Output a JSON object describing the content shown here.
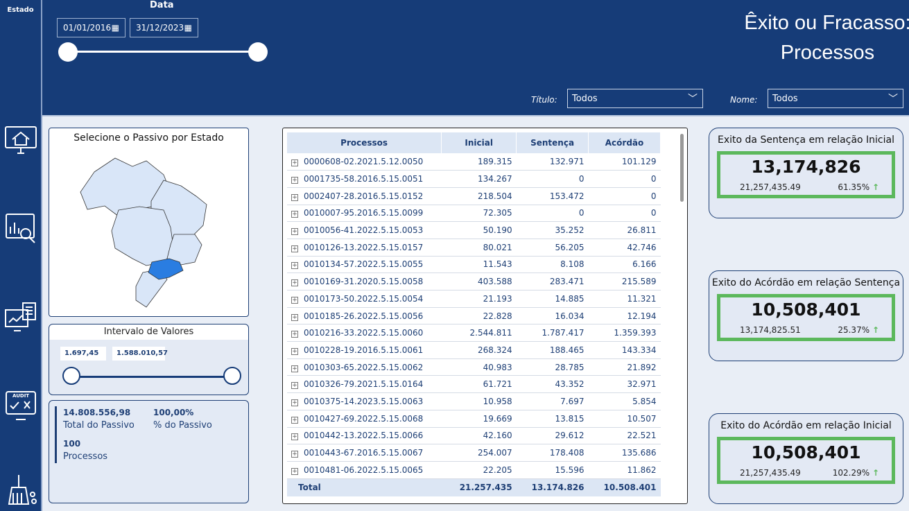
{
  "sidebar": {
    "label": "Estado",
    "icons": [
      "home-monitor-icon",
      "analytics-icon",
      "reports-icon",
      "audit-icon",
      "cleanup-icon"
    ]
  },
  "header": {
    "date_label": "Data",
    "date_start": "01/01/2016",
    "date_end": "31/12/2023",
    "title_line1": "Êxito ou Fracasso:",
    "title_line2": "Processos",
    "titulo_label": "Título:",
    "titulo_value": "Todos",
    "nome_label": "Nome:",
    "nome_value": "Todos",
    "date_range_fraction": [
      0,
      1
    ]
  },
  "map": {
    "title": "Selecione o Passivo por Estado",
    "highlighted_state": "SP"
  },
  "interval": {
    "title": "Intervalo de Valores",
    "min": "1.697,45",
    "max": "1.588.010,57"
  },
  "kpi": {
    "total_value": "14.808.556,98",
    "total_label": "Total do Passivo",
    "pct_value": "100,00%",
    "pct_label": "% do Passivo",
    "count_value": "100",
    "count_label": "Processos"
  },
  "table": {
    "columns": [
      "Processos",
      "Inicial",
      "Sentença",
      "Acórdão"
    ],
    "rows": [
      [
        "0000608-02.2021.5.12.0050",
        "189.315",
        "132.971",
        "101.129"
      ],
      [
        "0001735-58.2016.5.15.0051",
        "134.267",
        "0",
        "0"
      ],
      [
        "0002407-28.2016.5.15.0152",
        "218.504",
        "153.472",
        "0"
      ],
      [
        "0010007-95.2016.5.15.0099",
        "72.305",
        "0",
        "0"
      ],
      [
        "0010056-41.2022.5.15.0053",
        "50.190",
        "35.252",
        "26.811"
      ],
      [
        "0010126-13.2022.5.15.0157",
        "80.021",
        "56.205",
        "42.746"
      ],
      [
        "0010134-57.2022.5.15.0055",
        "11.543",
        "8.108",
        "6.166"
      ],
      [
        "0010169-31.2020.5.15.0058",
        "403.588",
        "283.471",
        "215.589"
      ],
      [
        "0010173-50.2022.5.15.0054",
        "21.193",
        "14.885",
        "11.321"
      ],
      [
        "0010185-26.2022.5.15.0056",
        "22.828",
        "16.034",
        "12.194"
      ],
      [
        "0010216-33.2022.5.15.0060",
        "2.544.811",
        "1.787.417",
        "1.359.393"
      ],
      [
        "0010228-19.2016.5.15.0061",
        "268.324",
        "188.465",
        "143.334"
      ],
      [
        "0010303-65.2022.5.15.0062",
        "40.983",
        "28.785",
        "21.892"
      ],
      [
        "0010326-79.2021.5.15.0164",
        "61.721",
        "43.352",
        "32.971"
      ],
      [
        "0010375-14.2023.5.15.0063",
        "10.958",
        "7.697",
        "5.854"
      ],
      [
        "0010427-69.2022.5.15.0068",
        "19.669",
        "13.815",
        "10.507"
      ],
      [
        "0010442-13.2022.5.15.0066",
        "42.160",
        "29.612",
        "22.521"
      ],
      [
        "0010443-67.2016.5.15.0067",
        "254.007",
        "178.408",
        "135.686"
      ],
      [
        "0010481-06.2022.5.15.0065",
        "22.205",
        "15.596",
        "11.862"
      ]
    ],
    "total": [
      "Total",
      "21.257.435",
      "13.174.826",
      "10.508.401"
    ]
  },
  "cards": [
    {
      "title": "Exito da Sentença em relação Inicial",
      "value": "13,174,826",
      "base": "21,257,435.49",
      "pct": "61.35%",
      "arrow": "↑"
    },
    {
      "title": "Exito do Acórdão em relação Sentença",
      "value": "10,508,401",
      "base": "13,174,825.51",
      "pct": "25.37%",
      "arrow": "↑"
    },
    {
      "title": "Exito do Acórdão em relação Inicial",
      "value": "10,508,401",
      "base": "21,257,435.49",
      "pct": "102.29%",
      "arrow": "↑"
    }
  ],
  "colors": {
    "navy": "#163c78",
    "green": "#5cb85c",
    "highlight": "#2a7de1"
  }
}
